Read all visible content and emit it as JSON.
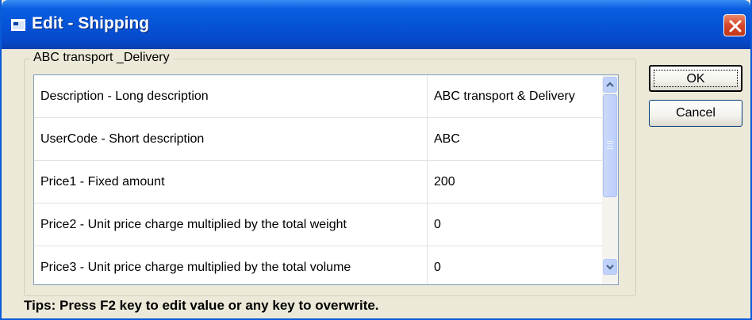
{
  "window": {
    "title": "Edit - Shipping"
  },
  "group": {
    "label": "ABC transport _Delivery"
  },
  "rows": [
    {
      "desc": "Description - Long description",
      "value": "ABC transport & Delivery"
    },
    {
      "desc": "UserCode - Short description",
      "value": "ABC"
    },
    {
      "desc": "Price1 - Fixed amount",
      "value": "200"
    },
    {
      "desc": "Price2 - Unit price charge multiplied by the total weight",
      "value": "0"
    },
    {
      "desc": "Price3 - Unit price charge multiplied by the total volume",
      "value": "0"
    }
  ],
  "buttons": {
    "ok": "OK",
    "cancel": "Cancel"
  },
  "tips": "Tips: Press F2 key to edit value or any key to overwrite.",
  "icons": {
    "title": "window-icon",
    "close": "close-icon",
    "scroll_up": "chevron-up-icon",
    "scroll_down": "chevron-down-icon"
  },
  "colors": {
    "titlebar": "#0552d6",
    "close": "#d5452a",
    "dialog_bg": "#ece9d8",
    "scrollbar": "#bccdf9"
  }
}
